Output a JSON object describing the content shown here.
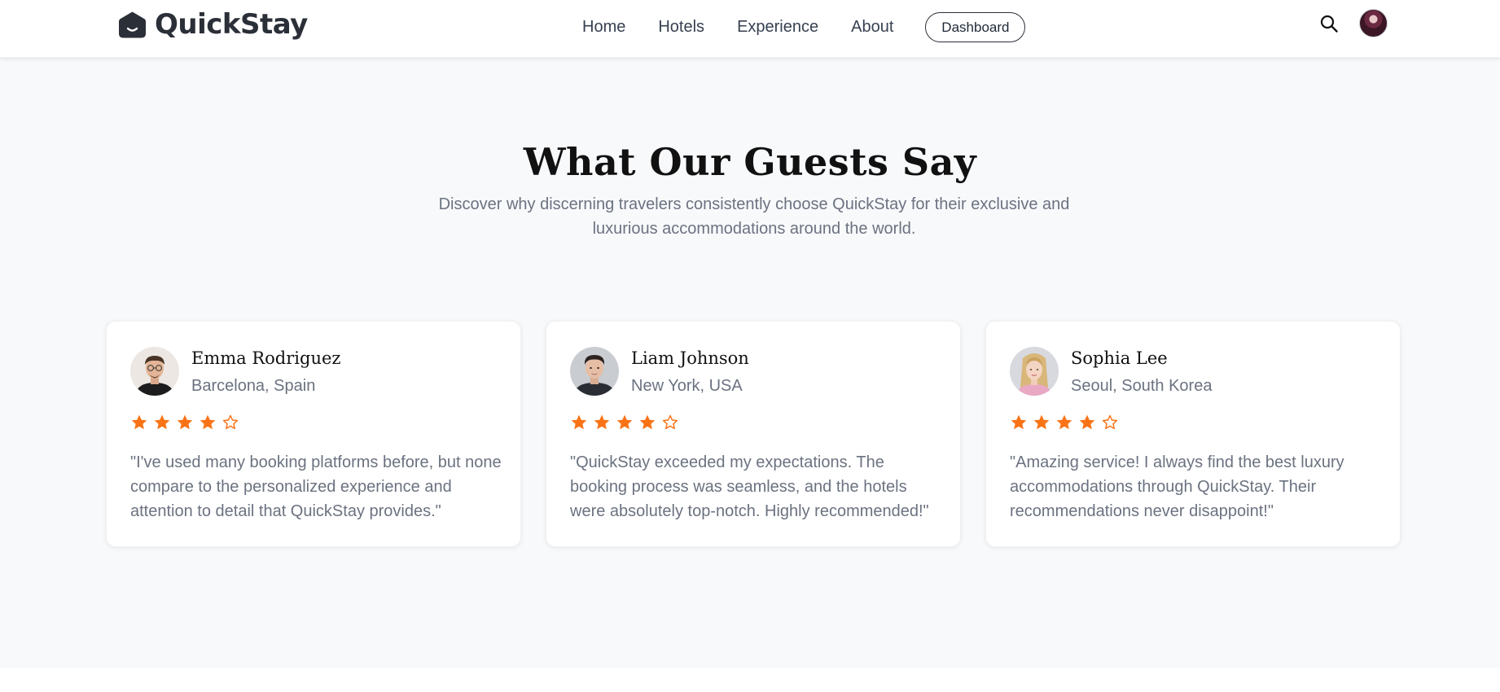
{
  "brand": {
    "name": "QuickStay"
  },
  "nav": {
    "links": [
      "Home",
      "Hotels",
      "Experience",
      "About"
    ],
    "dashboard_label": "Dashboard",
    "search_icon": "search-icon",
    "user_avatar": "user-avatar"
  },
  "section": {
    "title": "What Our Guests Say",
    "subtitle": "Discover why discerning travelers consistently choose QuickStay for their exclusive and luxurious accommodations around the world."
  },
  "testimonials": [
    {
      "name": "Emma Rodriguez",
      "location": "Barcelona, Spain",
      "rating": 4,
      "max_rating": 5,
      "quote": "\"I've used many booking platforms before, but none compare to the personalized experience and attention to detail that QuickStay provides.\""
    },
    {
      "name": "Liam Johnson",
      "location": "New York, USA",
      "rating": 4,
      "max_rating": 5,
      "quote": "\"QuickStay exceeded my expectations. The booking process was seamless, and the hotels were absolutely top-notch. Highly recommended!\""
    },
    {
      "name": "Sophia Lee",
      "location": "Seoul, South Korea",
      "rating": 4,
      "max_rating": 5,
      "quote": "\"Amazing service! I always find the best luxury accommodations through QuickStay. Their recommendations never disappoint!\""
    }
  ],
  "colors": {
    "star": "#f97316",
    "page_bg": "#f8f9fb",
    "text_muted": "#6b7280",
    "heading": "#111111"
  }
}
